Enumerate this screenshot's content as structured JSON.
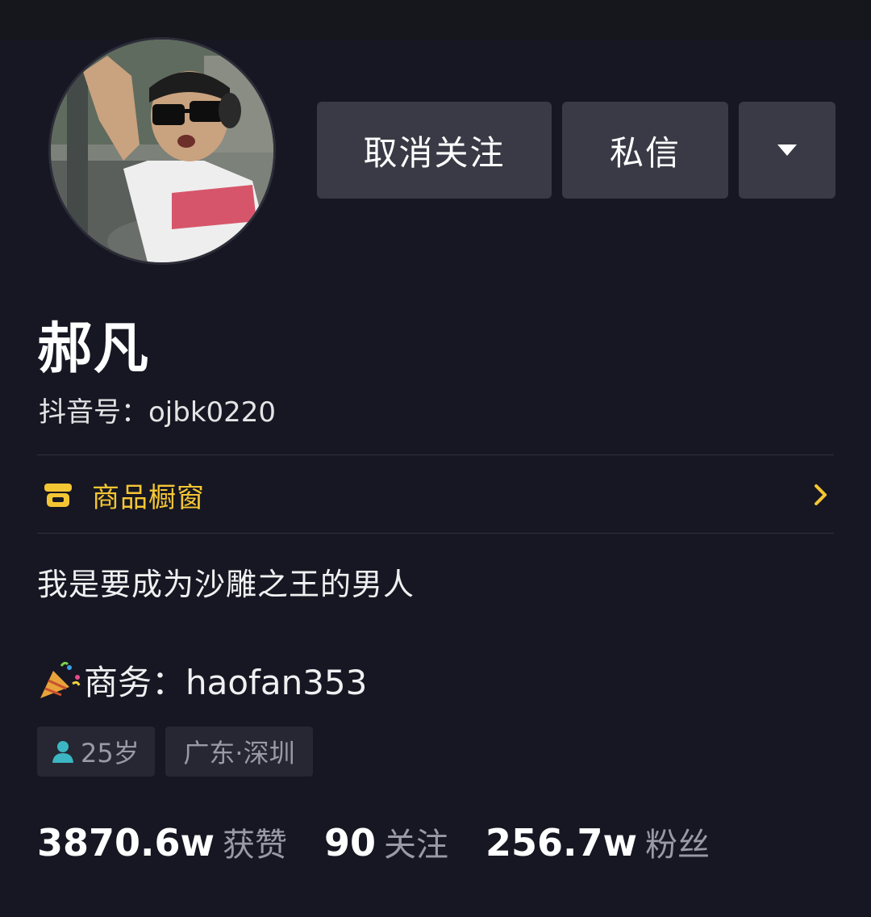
{
  "profile": {
    "name": "郝凡",
    "douyin_id": "抖音号：ojbk0220"
  },
  "actions": {
    "unfollow_label": "取消关注",
    "message_label": "私信",
    "more_icon": "triangle-down-icon"
  },
  "shop": {
    "label": "商品橱窗",
    "icon": "shop-icon",
    "accent_color": "#f5c634"
  },
  "bio": {
    "line1": "我是要成为沙雕之王的男人",
    "line2": "商务：haofan353",
    "line2_icon": "party-popper-icon"
  },
  "tags": {
    "age": "25岁",
    "age_icon": "person-icon",
    "location": "广东·深圳"
  },
  "stats": {
    "likes_value": "3870.6w",
    "likes_label": "获赞",
    "following_value": "90",
    "following_label": "关注",
    "followers_value": "256.7w",
    "followers_label": "粉丝"
  },
  "colors": {
    "background": "#161722",
    "button": "#393a45",
    "tag": "#262732"
  }
}
